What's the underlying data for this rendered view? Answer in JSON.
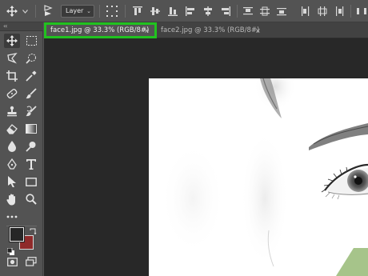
{
  "options_bar": {
    "move_icon": "move-icon",
    "layer_select": "Layer"
  },
  "tabs": [
    {
      "label": "face1.jpg @ 33.3% (RGB/8#)",
      "close": "×",
      "active": true
    },
    {
      "label": "face2.jpg @ 33.3% (RGB/8#)",
      "close": "×",
      "active": false
    }
  ],
  "toolbar": {
    "collapse_glyph": "‹‹",
    "tools": [
      "move-tool",
      "marquee-tool",
      "lasso-tool",
      "quick-selection-tool",
      "crop-tool",
      "eyedropper-tool",
      "healing-brush-tool",
      "brush-tool",
      "clone-stamp-tool",
      "history-brush-tool",
      "eraser-tool",
      "gradient-tool",
      "blur-tool",
      "dodge-tool",
      "pen-tool",
      "type-tool",
      "path-selection-tool",
      "rectangle-tool",
      "hand-tool",
      "zoom-tool",
      "more-tools"
    ],
    "foreground_color": "#262626",
    "background_color": "#8f2a2a"
  },
  "colors": {
    "highlight": "#21c21f",
    "canvas_bg": "#282828"
  }
}
